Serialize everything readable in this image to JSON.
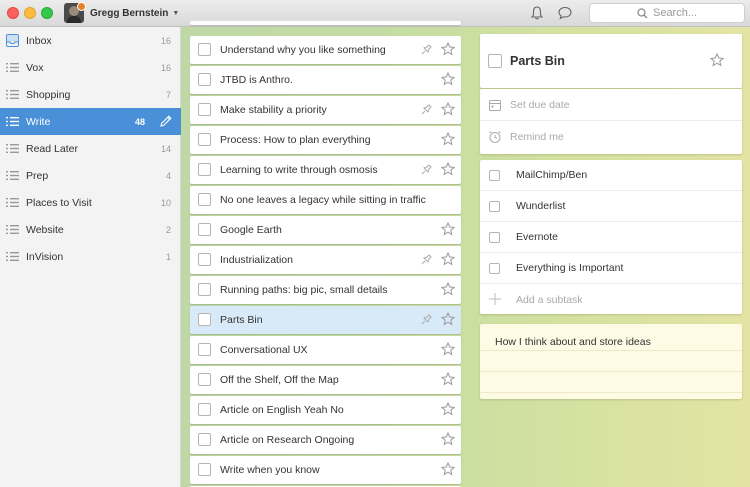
{
  "user": {
    "name": "Gregg Bernstein"
  },
  "search": {
    "placeholder": "Search..."
  },
  "sidebar": {
    "items": [
      {
        "label": "Inbox",
        "count": "16",
        "icon": "inbox-icon"
      },
      {
        "label": "Vox",
        "count": "16",
        "icon": "list-icon"
      },
      {
        "label": "Shopping",
        "count": "7",
        "icon": "list-icon"
      },
      {
        "label": "Write",
        "count": "48",
        "icon": "list-icon",
        "active": true
      },
      {
        "label": "Read Later",
        "count": "14",
        "icon": "list-icon"
      },
      {
        "label": "Prep",
        "count": "4",
        "icon": "list-icon"
      },
      {
        "label": "Places to Visit",
        "count": "10",
        "icon": "list-icon"
      },
      {
        "label": "Website",
        "count": "2",
        "icon": "list-icon"
      },
      {
        "label": "InVision",
        "count": "1",
        "icon": "list-icon"
      }
    ]
  },
  "tasks": [
    {
      "title": "Understand why you like something",
      "pinned": true
    },
    {
      "title": "JTBD is Anthro.",
      "pinned": false
    },
    {
      "title": "Make stability a priority",
      "pinned": true
    },
    {
      "title": "Process: How to plan everything",
      "pinned": false
    },
    {
      "title": "Learning to write through osmosis",
      "pinned": true
    },
    {
      "title": "No one leaves a legacy while sitting in traffic",
      "pinned": false
    },
    {
      "title": "Google Earth",
      "pinned": false
    },
    {
      "title": "Industrialization",
      "pinned": true
    },
    {
      "title": "Running paths: big pic, small details",
      "pinned": false
    },
    {
      "title": "Parts Bin",
      "pinned": true,
      "selected": true
    },
    {
      "title": "Conversational UX",
      "pinned": false
    },
    {
      "title": "Off the Shelf, Off the Map",
      "pinned": false
    },
    {
      "title": "Article on English Yeah No",
      "pinned": false
    },
    {
      "title": "Article on Research Ongoing",
      "pinned": false
    },
    {
      "title": "Write when you know",
      "pinned": false
    }
  ],
  "detail": {
    "title": "Parts Bin",
    "due_date_label": "Set due date",
    "remind_label": "Remind me",
    "subtasks": [
      "MailChimp/Ben",
      "Wunderlist",
      "Evernote",
      "Everything is Important"
    ],
    "add_subtask_label": "Add a subtask",
    "note": "How I think about and store ideas"
  },
  "colors": {
    "accent": "#4a90d9",
    "selected_task": "#d8e9f8"
  }
}
